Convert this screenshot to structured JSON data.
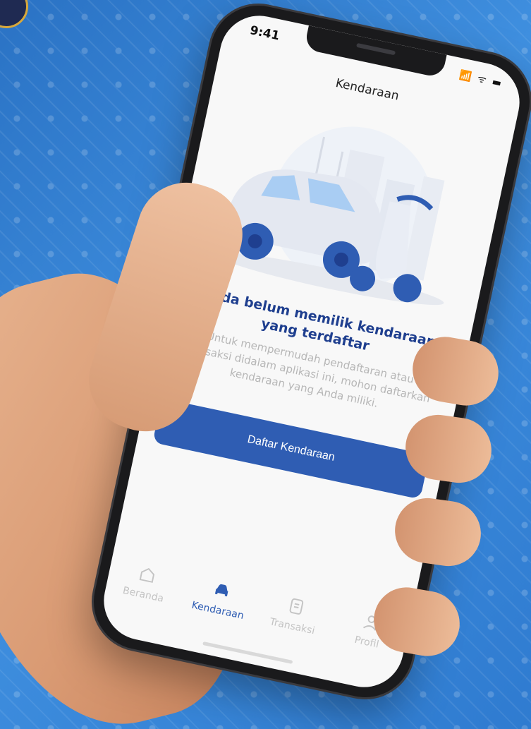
{
  "status": {
    "time": "9:41",
    "icons": "📶 ᯤ ▬"
  },
  "header": {
    "title": "Kendaraan"
  },
  "empty_state": {
    "title_line1": "Anda belum memilik kendaraan",
    "title_line2": "yang terdaftar",
    "description_line1": "Untuk mempermudah pendaftaran atau",
    "description_line2": "transaksi didalam aplikasi ini, mohon daftarkan",
    "description_line3": "kendaraan yang Anda miliki."
  },
  "actions": {
    "primary_label": "Daftar Kendaraan"
  },
  "tabbar": {
    "items": [
      {
        "label": "Beranda",
        "icon": "home-icon"
      },
      {
        "label": "Kendaraan",
        "icon": "car-icon"
      },
      {
        "label": "Transaksi",
        "icon": "receipt-icon"
      },
      {
        "label": "Profil",
        "icon": "user-icon"
      }
    ],
    "active_index": 1
  },
  "colors": {
    "accent": "#2f5db3",
    "title": "#1f3f8f",
    "muted_text": "#b6b6b6",
    "background": "#3f8fdf"
  }
}
